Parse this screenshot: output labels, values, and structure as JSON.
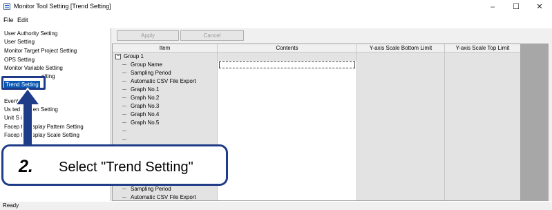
{
  "window": {
    "title": "Monitor Tool Setting [Trend Setting]",
    "minimize": "–",
    "maximize": "☐",
    "close": "✕"
  },
  "menu": [
    "File",
    "Edit"
  ],
  "sidebar": {
    "items": [
      {
        "label": "User Authority Setting"
      },
      {
        "label": "User Setting"
      },
      {
        "label": "Monitor Target Project Setting"
      },
      {
        "label": "OPS Setting"
      },
      {
        "label": "Monitor Variable Setting"
      },
      {
        "label": "etting"
      },
      {
        "label": "Trend Setting",
        "selected": true
      },
      {
        "label": "Event etting"
      },
      {
        "label": "Us ted Screen Setting"
      },
      {
        "label": "Unit S ing"
      },
      {
        "label": "Facep te Display Pattern Setting"
      },
      {
        "label": "Facep te Display Scale Setting"
      }
    ]
  },
  "toolbar": {
    "apply_label": "Apply",
    "cancel_label": "Cancel"
  },
  "table": {
    "columns": [
      "Item",
      "Contents",
      "Y-axis Scale Bottom Limit",
      "Y-axis Scale Top Limit"
    ],
    "group_label": "Group 1",
    "expander": "−",
    "rows": [
      "Group Name",
      "Sampling Period",
      "Automatic CSV File Export",
      "Graph No.1",
      "Graph No.2",
      "Graph No.3",
      "Graph No.4",
      "Graph No.5"
    ],
    "bottom_rows": [
      "Sampling Period",
      "Automatic CSV File Export"
    ]
  },
  "status": {
    "text": "Ready"
  },
  "callout": {
    "step": "2.",
    "text": "Select \"Trend Setting\""
  },
  "colors": {
    "selection": "#0a58b3",
    "annotation": "#1f3c88",
    "scrollbar_area": "#a7a7a7"
  }
}
